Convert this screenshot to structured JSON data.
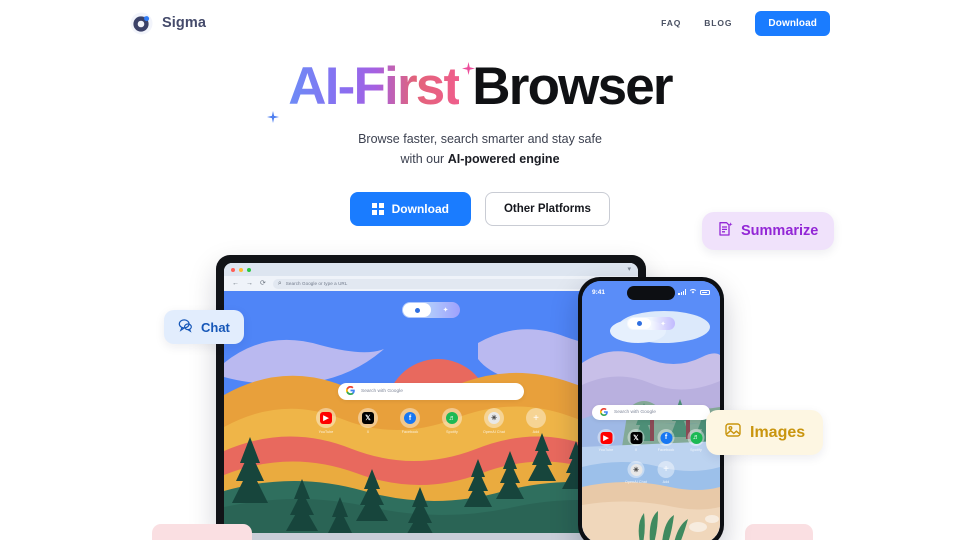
{
  "brand": {
    "name": "Sigma",
    "logo_icon": "sigma-ring-logo"
  },
  "nav": {
    "links": [
      {
        "label": "FAQ",
        "name": "faq"
      },
      {
        "label": "BLOG",
        "name": "blog"
      }
    ],
    "download_label": "Download"
  },
  "hero": {
    "headline_gradient": "AI-First",
    "headline_solid": " Browser",
    "subtitle_line1": "Browse faster, search smarter and stay safe",
    "subtitle_line2_prefix": "with our ",
    "subtitle_line2_bold": "AI-powered engine",
    "primary_cta": "Download",
    "primary_cta_icon": "windows-icon",
    "secondary_cta": "Other Platforms"
  },
  "feature_pills": [
    {
      "label": "Summarize",
      "icon": "summarize-doc-icon",
      "color": "#9327d6",
      "bg": "#f0e2fb"
    },
    {
      "label": "Chat",
      "icon": "chat-bubbles-icon",
      "color": "#1657b8",
      "bg": "#e2edfd"
    },
    {
      "label": "Images",
      "icon": "image-icon",
      "color": "#c9950e",
      "bg": "#fdf6e2"
    }
  ],
  "laptop": {
    "url_placeholder": "Search Google or type a URL",
    "back_icon": "arrow-left-icon",
    "forward_icon": "arrow-right-icon",
    "reload_icon": "reload-icon",
    "search_placeholder": "Search with Google",
    "google_g": "G",
    "shortcuts": [
      {
        "label": "YouTube",
        "icon": "youtube-icon"
      },
      {
        "label": "X",
        "icon": "x-icon"
      },
      {
        "label": "Facebook",
        "icon": "facebook-icon"
      },
      {
        "label": "Spotify",
        "icon": "spotify-icon"
      },
      {
        "label": "OpenAI Chat",
        "icon": "openai-icon"
      },
      {
        "label": "Add",
        "icon": "plus-icon"
      }
    ]
  },
  "phone": {
    "time": "9:41",
    "search_placeholder": "Search with Google",
    "google_g": "G",
    "shortcuts_row1": [
      {
        "label": "YouTube",
        "icon": "youtube-icon"
      },
      {
        "label": "X",
        "icon": "x-icon"
      },
      {
        "label": "Facebook",
        "icon": "facebook-icon"
      },
      {
        "label": "Spotify",
        "icon": "spotify-icon"
      }
    ],
    "shortcuts_row2": [
      {
        "label": "OpenAI Chat",
        "icon": "openai-icon"
      },
      {
        "label": "Add",
        "icon": "plus-icon"
      }
    ]
  },
  "colors": {
    "accent_blue": "#1a7cff",
    "headline_start": "#6d8cf6",
    "headline_end": "#ef5e8c",
    "text_dark": "#101114",
    "brand_text": "#454b6b"
  }
}
